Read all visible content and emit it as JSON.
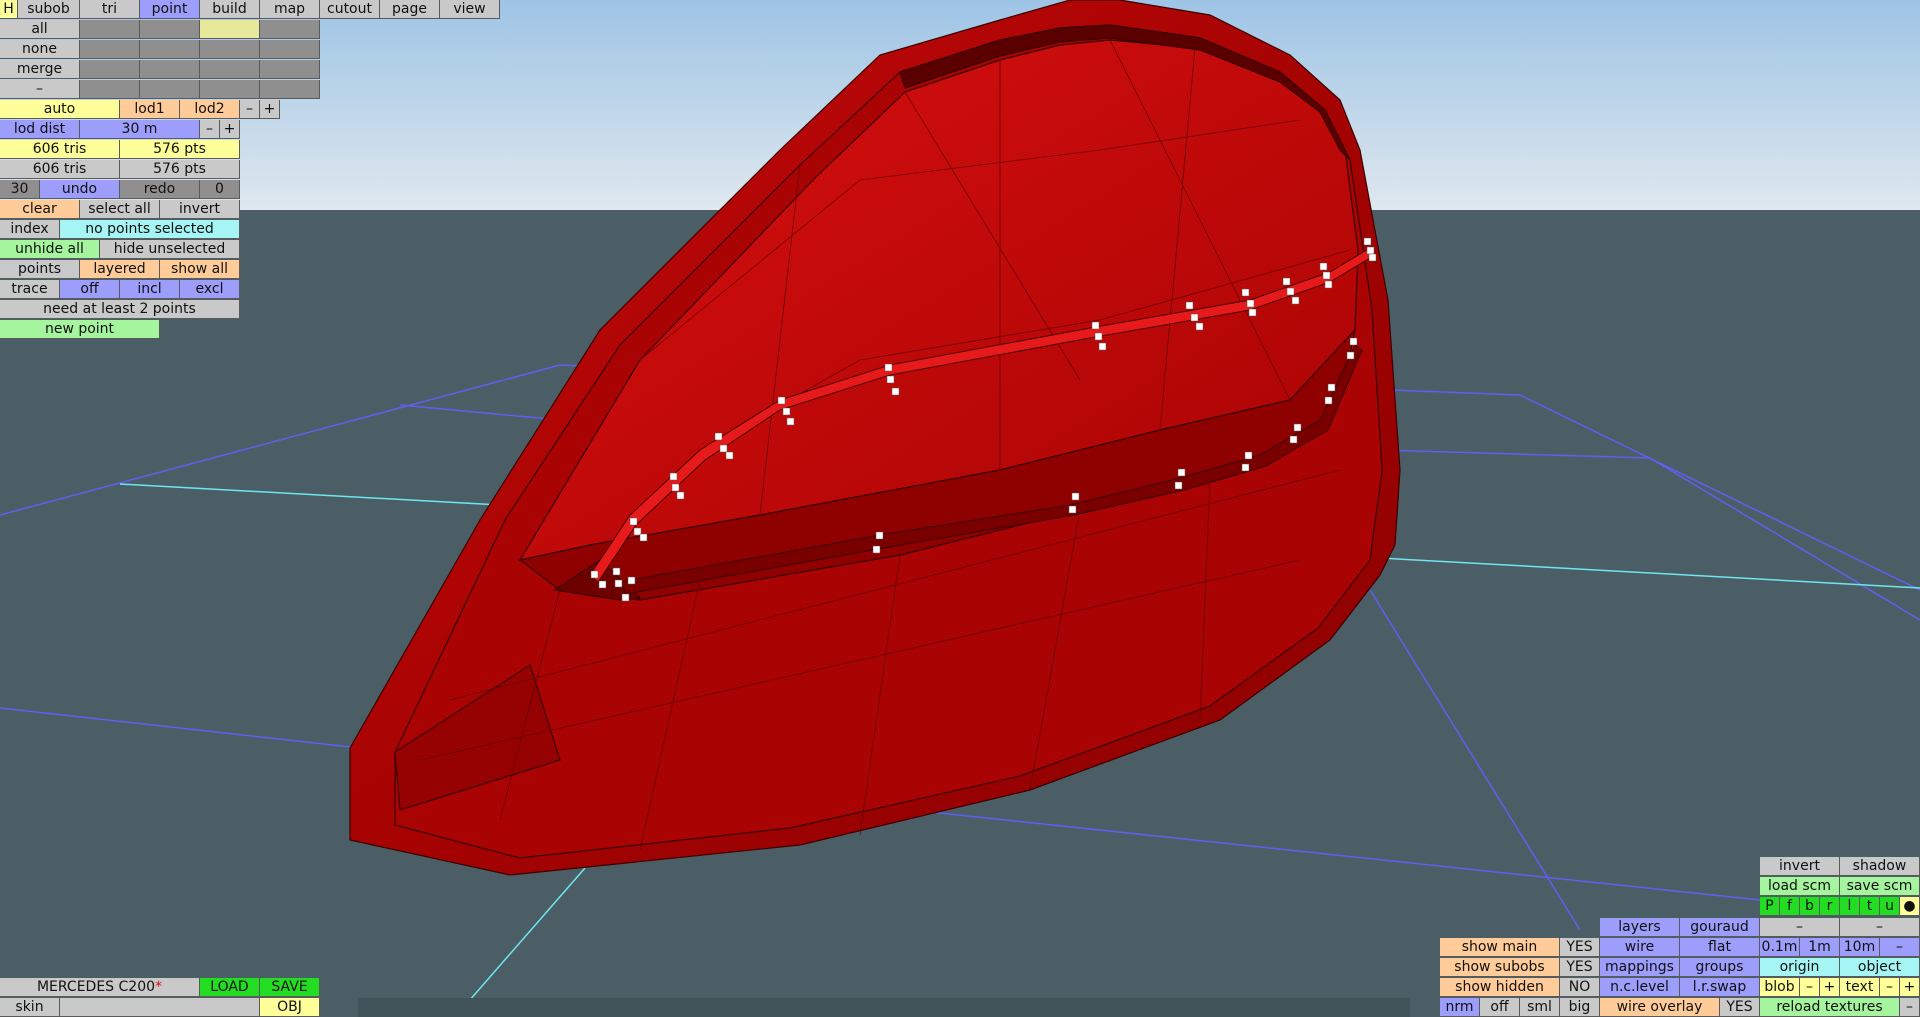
{
  "top_menu": {
    "h": "H",
    "subob": "subob",
    "tri": "tri",
    "point": "point",
    "build": "build",
    "map": "map",
    "cutout": "cutout",
    "page": "page",
    "view": "view"
  },
  "sel_col": {
    "all": "all",
    "none": "none",
    "merge": "merge",
    "minus": "–"
  },
  "lod": {
    "auto": "auto",
    "lod1": "lod1",
    "lod2": "lod2",
    "minus": "–",
    "plus": "+"
  },
  "lod_dist": {
    "label": "lod dist",
    "value": "30 m",
    "minus": "–",
    "plus": "+"
  },
  "stats": {
    "tris1": "606 tris",
    "pts1": "576 pts",
    "tris2": "606 tris",
    "pts2": "576 pts"
  },
  "undo_row": {
    "count": "30",
    "undo": "undo",
    "redo": "redo",
    "redo_count": "0"
  },
  "sel_row": {
    "clear": "clear",
    "select_all": "select all",
    "invert": "invert"
  },
  "index_row": {
    "index": "index",
    "status": "no points selected"
  },
  "hide_row": {
    "unhide_all": "unhide all",
    "hide_unselected": "hide unselected"
  },
  "points_row": {
    "points": "points",
    "layered": "layered",
    "show_all": "show all"
  },
  "trace_row": {
    "trace": "trace",
    "off": "off",
    "incl": "incl",
    "excl": "excl"
  },
  "message": "need at least 2 points",
  "new_point": "new point",
  "file": {
    "name": "MERCEDES C200",
    "star": "*",
    "load": "LOAD",
    "save": "SAVE",
    "skin": "skin",
    "obj": "OBJ"
  },
  "br": {
    "invert": "invert",
    "shadow": "shadow",
    "load_scm": "load scm",
    "save_scm": "save scm",
    "modes": [
      "P",
      "f",
      "b",
      "r",
      "l",
      "t",
      "u",
      "●"
    ],
    "layers": "layers",
    "gouraud": "gouraud",
    "dash": "–",
    "show_main": "show main",
    "show_main_val": "YES",
    "wire": "wire",
    "flat": "flat",
    "g01": "0.1m",
    "g1": "1m",
    "g10": "10m",
    "show_subobs": "show subobs",
    "show_subobs_val": "YES",
    "mappings": "mappings",
    "groups": "groups",
    "origin": "origin",
    "object": "object",
    "show_hidden": "show hidden",
    "show_hidden_val": "NO",
    "nclevel": "n.c.level",
    "lrswap": "l.r.swap",
    "blob": "blob",
    "minus": "–",
    "plus": "+",
    "text": "text",
    "nrm": "nrm",
    "off": "off",
    "sml": "sml",
    "big": "big",
    "wire_overlay": "wire overlay",
    "wire_overlay_val": "YES",
    "reload": "reload textures"
  },
  "colors": {
    "sky_top": "#9ec4e6",
    "sky_bottom": "#dfe8ee",
    "floor": "#4b5e66",
    "mesh": "#b40404",
    "grid_blue": "#5f5ff0",
    "grid_cyan": "#6fe6ef"
  }
}
